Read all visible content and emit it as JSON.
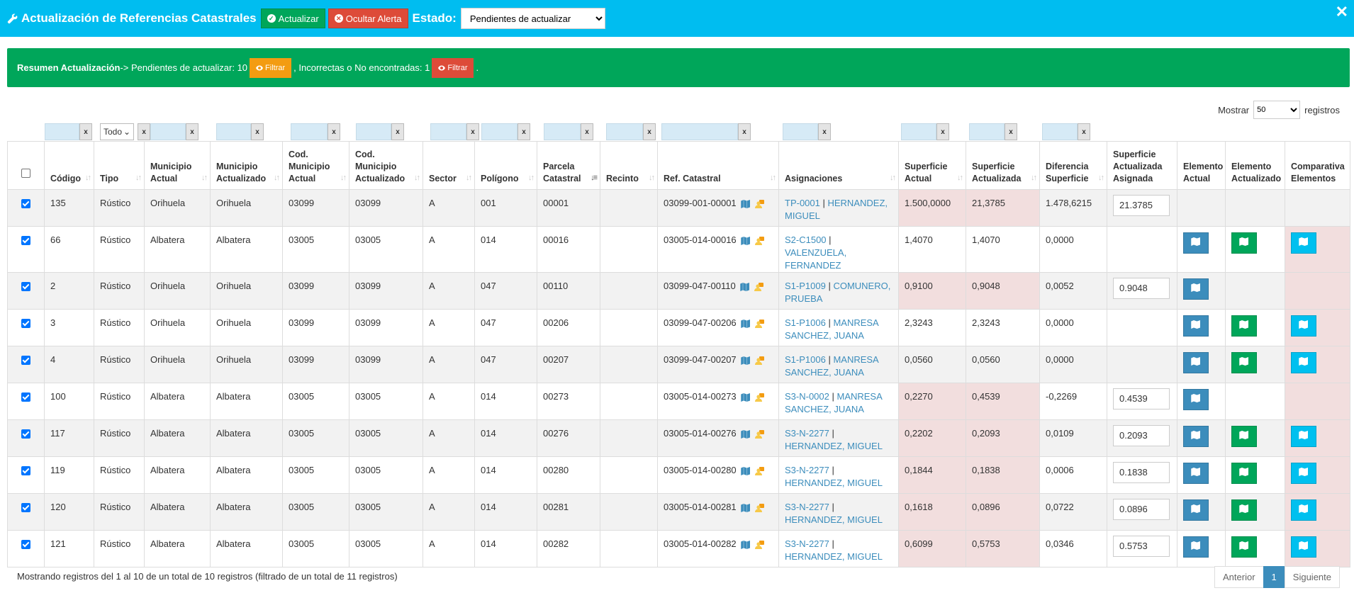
{
  "header": {
    "title": "Actualización de Referencias Catastrales",
    "actualizar_label": "Actualizar",
    "ocultar_label": "Ocultar Alerta",
    "estado_label": "Estado:",
    "estado_value": "Pendientes de actualizar",
    "close_glyph": "✕"
  },
  "alert": {
    "resumen_label": "Resumen Actualización",
    "pendientes_text": " -> Pendientes de actualizar: 10",
    "incorrectas_text": ", Incorrectas o No encontradas: 1",
    "end_text": ".",
    "filtrar_label": "Filtrar"
  },
  "length_menu": {
    "prefix": "Mostrar",
    "value": "50",
    "suffix": "registros"
  },
  "filters": {
    "tipo_value": "Todo",
    "clear_label": "x"
  },
  "table": {
    "headers": {
      "codigo": "Código",
      "tipo": "Tipo",
      "municipio_actual": "Municipio Actual",
      "municipio_actualizado": "Municipio Actualizado",
      "cod_municipio_actual": "Cod. Municipio Actual",
      "cod_municipio_actualizado": "Cod. Municipio Actualizado",
      "sector": "Sector",
      "poligono": "Polígono",
      "parcela": "Parcela Catastral",
      "recinto": "Recinto",
      "ref_catastral": "Ref. Catastral",
      "asignaciones": "Asignaciones",
      "sup_actual": "Superficie Actual",
      "sup_actualizada": "Superficie Actualizada",
      "diferencia": "Diferencia Superficie",
      "sup_asignada": "Superficie Actualizada Asignada",
      "elem_actual": "Elemento Actual",
      "elem_actualizado": "Elemento Actualizado",
      "comparativa": "Comparativa Elementos"
    },
    "rows": [
      {
        "codigo": "135",
        "tipo": "Rústico",
        "mun_act": "Orihuela",
        "mun_upd": "Orihuela",
        "cod_act": "03099",
        "cod_upd": "03099",
        "sector": "A",
        "poligono": "001",
        "parcela": "00001",
        "recinto": "",
        "ref": "03099-001-00001",
        "asig_code": "TP-0001",
        "asig_name": "HERNANDEZ, MIGUEL",
        "sup_act": "1.500,0000",
        "sup_upd": "21,3785",
        "dif": "1.478,6215",
        "asignada": "21.3785",
        "sup_pink": true,
        "elem_act": false,
        "elem_upd": false,
        "comp": false,
        "comp_pink": false
      },
      {
        "codigo": "66",
        "tipo": "Rústico",
        "mun_act": "Albatera",
        "mun_upd": "Albatera",
        "cod_act": "03005",
        "cod_upd": "03005",
        "sector": "A",
        "poligono": "014",
        "parcela": "00016",
        "recinto": "",
        "ref": "03005-014-00016",
        "asig_code": "S2-C1500",
        "asig_name": "VALENZUELA, FERNANDEZ",
        "sup_act": "1,4070",
        "sup_upd": "1,4070",
        "dif": "0,0000",
        "asignada": "",
        "sup_pink": false,
        "elem_act": true,
        "elem_upd": true,
        "comp": true,
        "comp_pink": true
      },
      {
        "codigo": "2",
        "tipo": "Rústico",
        "mun_act": "Orihuela",
        "mun_upd": "Orihuela",
        "cod_act": "03099",
        "cod_upd": "03099",
        "sector": "A",
        "poligono": "047",
        "parcela": "00110",
        "recinto": "",
        "ref": "03099-047-00110",
        "asig_code": "S1-P1009",
        "asig_name": "COMUNERO, PRUEBA",
        "sup_act": "0,9100",
        "sup_upd": "0,9048",
        "dif": "0,0052",
        "asignada": "0.9048",
        "sup_pink": true,
        "elem_act": true,
        "elem_upd": false,
        "comp": false,
        "comp_pink": true
      },
      {
        "codigo": "3",
        "tipo": "Rústico",
        "mun_act": "Orihuela",
        "mun_upd": "Orihuela",
        "cod_act": "03099",
        "cod_upd": "03099",
        "sector": "A",
        "poligono": "047",
        "parcela": "00206",
        "recinto": "",
        "ref": "03099-047-00206",
        "asig_code": "S1-P1006",
        "asig_name": "MANRESA SANCHEZ, JUANA",
        "sup_act": "2,3243",
        "sup_upd": "2,3243",
        "dif": "0,0000",
        "asignada": "",
        "sup_pink": false,
        "elem_act": true,
        "elem_upd": true,
        "comp": true,
        "comp_pink": true
      },
      {
        "codigo": "4",
        "tipo": "Rústico",
        "mun_act": "Orihuela",
        "mun_upd": "Orihuela",
        "cod_act": "03099",
        "cod_upd": "03099",
        "sector": "A",
        "poligono": "047",
        "parcela": "00207",
        "recinto": "",
        "ref": "03099-047-00207",
        "asig_code": "S1-P1006",
        "asig_name": "MANRESA SANCHEZ, JUANA",
        "sup_act": "0,0560",
        "sup_upd": "0,0560",
        "dif": "0,0000",
        "asignada": "",
        "sup_pink": false,
        "elem_act": true,
        "elem_upd": true,
        "comp": true,
        "comp_pink": true
      },
      {
        "codigo": "100",
        "tipo": "Rústico",
        "mun_act": "Albatera",
        "mun_upd": "Albatera",
        "cod_act": "03005",
        "cod_upd": "03005",
        "sector": "A",
        "poligono": "014",
        "parcela": "00273",
        "recinto": "",
        "ref": "03005-014-00273",
        "asig_code": "S3-N-0002",
        "asig_name": "MANRESA SANCHEZ, JUANA",
        "sup_act": "0,2270",
        "sup_upd": "0,4539",
        "dif": "-0,2269",
        "asignada": "0.4539",
        "sup_pink": true,
        "elem_act": true,
        "elem_upd": false,
        "comp": false,
        "comp_pink": true
      },
      {
        "codigo": "117",
        "tipo": "Rústico",
        "mun_act": "Albatera",
        "mun_upd": "Albatera",
        "cod_act": "03005",
        "cod_upd": "03005",
        "sector": "A",
        "poligono": "014",
        "parcela": "00276",
        "recinto": "",
        "ref": "03005-014-00276",
        "asig_code": "S3-N-2277",
        "asig_name": "HERNANDEZ, MIGUEL",
        "sup_act": "0,2202",
        "sup_upd": "0,2093",
        "dif": "0,0109",
        "asignada": "0.2093",
        "sup_pink": true,
        "elem_act": true,
        "elem_upd": true,
        "comp": true,
        "comp_pink": true
      },
      {
        "codigo": "119",
        "tipo": "Rústico",
        "mun_act": "Albatera",
        "mun_upd": "Albatera",
        "cod_act": "03005",
        "cod_upd": "03005",
        "sector": "A",
        "poligono": "014",
        "parcela": "00280",
        "recinto": "",
        "ref": "03005-014-00280",
        "asig_code": "S3-N-2277",
        "asig_name": "HERNANDEZ, MIGUEL",
        "sup_act": "0,1844",
        "sup_upd": "0,1838",
        "dif": "0,0006",
        "asignada": "0.1838",
        "sup_pink": true,
        "elem_act": true,
        "elem_upd": true,
        "comp": true,
        "comp_pink": true
      },
      {
        "codigo": "120",
        "tipo": "Rústico",
        "mun_act": "Albatera",
        "mun_upd": "Albatera",
        "cod_act": "03005",
        "cod_upd": "03005",
        "sector": "A",
        "poligono": "014",
        "parcela": "00281",
        "recinto": "",
        "ref": "03005-014-00281",
        "asig_code": "S3-N-2277",
        "asig_name": "HERNANDEZ, MIGUEL",
        "sup_act": "0,1618",
        "sup_upd": "0,0896",
        "dif": "0,0722",
        "asignada": "0.0896",
        "sup_pink": true,
        "elem_act": true,
        "elem_upd": true,
        "comp": true,
        "comp_pink": true
      },
      {
        "codigo": "121",
        "tipo": "Rústico",
        "mun_act": "Albatera",
        "mun_upd": "Albatera",
        "cod_act": "03005",
        "cod_upd": "03005",
        "sector": "A",
        "poligono": "014",
        "parcela": "00282",
        "recinto": "",
        "ref": "03005-014-00282",
        "asig_code": "S3-N-2277",
        "asig_name": "HERNANDEZ, MIGUEL",
        "sup_act": "0,6099",
        "sup_upd": "0,5753",
        "dif": "0,0346",
        "asignada": "0.5753",
        "sup_pink": true,
        "elem_act": true,
        "elem_upd": true,
        "comp": true,
        "comp_pink": true
      }
    ]
  },
  "footer": {
    "info": "Mostrando registros del 1 al 10 de un total de 10 registros (filtrado de un total de 11 registros)",
    "prev": "Anterior",
    "page": "1",
    "next": "Siguiente"
  },
  "colors": {
    "header_bg": "#00bdf0",
    "success": "#00a65a",
    "danger": "#dd4b39",
    "warning": "#f39c12",
    "primary": "#3c8dbc",
    "info": "#00c0ef",
    "row_highlight": "#f2dede"
  },
  "icons": {
    "title": "wrench-icon",
    "actualizar": "check-circle-icon",
    "ocultar": "times-circle-icon",
    "filtrar": "eye-icon",
    "ref_map": "map-icon",
    "ref_person": "user-assign-icon",
    "element": "map-icon"
  }
}
